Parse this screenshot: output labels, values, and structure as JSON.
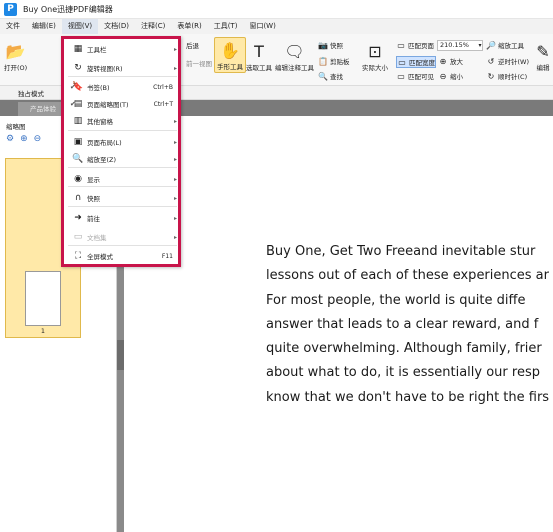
{
  "window": {
    "title": "Buy One迅捷PDF编辑器",
    "logo": "P"
  },
  "menubar": {
    "items": [
      {
        "label": "文件"
      },
      {
        "label": "编辑(E)"
      },
      {
        "label": "视图(V)"
      },
      {
        "label": "文档(D)"
      },
      {
        "label": "注释(C)"
      },
      {
        "label": "表单(R)"
      },
      {
        "label": "工具(T)"
      },
      {
        "label": "窗口(W)"
      }
    ],
    "active_index": 2
  },
  "ribbon": {
    "open_label": "打开(O)",
    "back_label": "后退",
    "prev_view_label": "前一视图",
    "hand_tool_label": "手形工具",
    "select_tool_label": "选取工具",
    "edit_annot_label": "编辑注释工具",
    "snapshot_label": "快照",
    "clipboard_label": "剪贴板",
    "find_label": "查找",
    "actual_size_label": "实际大小",
    "fit_page_label": "匹配页面",
    "fit_width_label": "匹配宽度",
    "fit_visible_label": "匹配可见",
    "zoom_value": "210.15%",
    "zoom_in_label": "放大",
    "zoom_out_label": "缩小",
    "zoom_tool_label": "缩放工具",
    "rotate_ccw_label": "逆时针(W)",
    "rotate_cw_label": "顺时针(C)",
    "edit_label": "编辑"
  },
  "toolrow": {
    "mode_label": "独占模式"
  },
  "tabs": [
    {
      "label": "产品体验"
    }
  ],
  "left_panel": {
    "title": "缩略图",
    "page_number": "1"
  },
  "view_menu": {
    "items": [
      {
        "icon": "toolbar-icon",
        "label": "工具栏",
        "shortcut": "",
        "submenu": true,
        "checked": false,
        "disabled": false
      },
      {
        "icon": "rotate-view-icon",
        "label": "旋转视图(R)",
        "shortcut": "",
        "submenu": true,
        "checked": false,
        "disabled": false
      },
      {
        "icon": "bookmark-icon",
        "label": "书签(B)",
        "shortcut": "Ctrl+B",
        "submenu": false,
        "checked": true,
        "disabled": false
      },
      {
        "icon": "page-thumbnail-icon",
        "label": "页面缩略图(T)",
        "shortcut": "Ctrl+T",
        "submenu": false,
        "checked": true,
        "disabled": false
      },
      {
        "icon": "other-panes-icon",
        "label": "其他窗格",
        "shortcut": "",
        "submenu": true,
        "checked": false,
        "disabled": false
      },
      {
        "icon": "page-layout-icon",
        "label": "页面布局(L)",
        "shortcut": "",
        "submenu": true,
        "checked": false,
        "disabled": false
      },
      {
        "icon": "zoom-icon",
        "label": "缩放至(Z)",
        "shortcut": "",
        "submenu": true,
        "checked": false,
        "disabled": false
      },
      {
        "icon": "display-icon",
        "label": "显示",
        "shortcut": "",
        "submenu": true,
        "checked": false,
        "disabled": false
      },
      {
        "icon": "snap-icon",
        "label": "快照",
        "shortcut": "",
        "submenu": true,
        "checked": false,
        "disabled": false
      },
      {
        "icon": "goto-icon",
        "label": "前往",
        "shortcut": "",
        "submenu": true,
        "checked": false,
        "disabled": false
      },
      {
        "icon": "reading-icon",
        "label": "文档集",
        "shortcut": "",
        "submenu": true,
        "checked": false,
        "disabled": true
      },
      {
        "icon": "fullscreen-icon",
        "label": "全屏模式",
        "shortcut": "F11",
        "submenu": false,
        "checked": false,
        "disabled": false
      }
    ]
  },
  "document": {
    "lines": [
      "Buy One, Get Two Freeand inevitable stur",
      "lessons out of each of these experiences ar",
      "For most people, the world is quite diffe",
      "answer that leads to a clear reward, and f",
      "quite overwhelming. Although family, frier",
      "about what to do, it is essentially our resp",
      "know that we don't have to be right the firs"
    ]
  },
  "colors": {
    "menu_border": "#c8144a",
    "accent": "#1e88e5",
    "highlight": "#ffe9a8"
  }
}
